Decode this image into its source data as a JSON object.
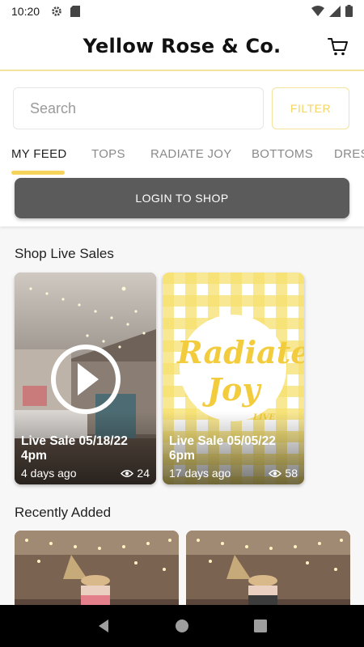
{
  "status_bar": {
    "time": "10:20"
  },
  "header": {
    "title": "Yellow Rose & Co."
  },
  "search": {
    "placeholder": "Search",
    "filter_label": "FILTER"
  },
  "tabs": [
    {
      "label": "MY FEED",
      "active": true
    },
    {
      "label": "TOPS"
    },
    {
      "label": "RADIATE JOY"
    },
    {
      "label": "BOTTOMS"
    },
    {
      "label": "DRES"
    }
  ],
  "login": {
    "label": "LOGIN TO SHOP"
  },
  "live_sales": {
    "title": "Shop Live Sales",
    "items": [
      {
        "title": "Live Sale 05/18/22 4pm",
        "ago": "4 days ago",
        "views": "24"
      },
      {
        "title": "Live Sale 05/05/22 6pm",
        "ago": "17 days ago",
        "views": "58"
      }
    ]
  },
  "recently_added": {
    "title": "Recently Added"
  },
  "colors": {
    "accent": "#f6d45b",
    "button": "#5b5b5b"
  }
}
